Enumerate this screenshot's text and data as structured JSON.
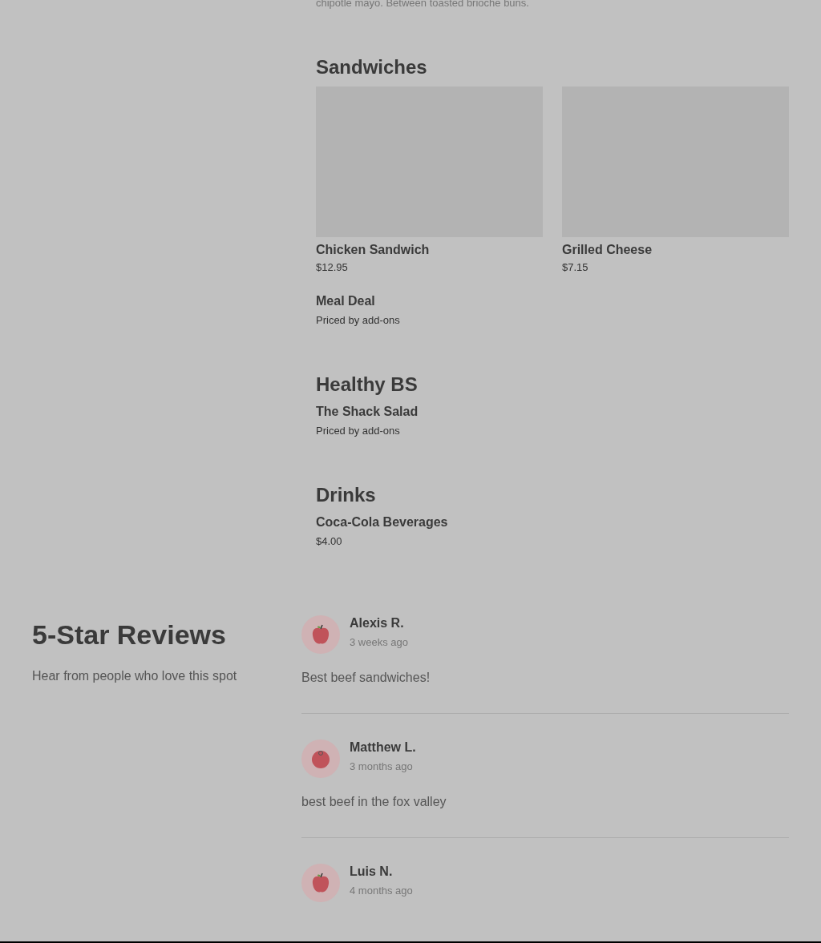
{
  "intro_text": "chipotle mayo. Between toasted brioche buns.",
  "menu_sections": [
    {
      "title": "Sandwiches",
      "items": [
        {
          "kind": "card",
          "name": "Chicken Sandwich",
          "price": "$12.95"
        },
        {
          "kind": "card",
          "name": "Grilled Cheese",
          "price": "$7.15"
        },
        {
          "kind": "row",
          "name": "Meal Deal",
          "price": "Priced by add-ons"
        }
      ]
    },
    {
      "title": "Healthy BS",
      "items": [
        {
          "kind": "row",
          "name": "The Shack Salad",
          "price": "Priced by add-ons"
        }
      ]
    },
    {
      "title": "Drinks",
      "items": [
        {
          "kind": "row",
          "name": "Coca-Cola Beverages",
          "price": "$4.00"
        }
      ]
    }
  ],
  "reviews": {
    "title": "5-Star Reviews",
    "subtitle": "Hear from people who love this spot",
    "items": [
      {
        "kind": "apple",
        "name": "Alexis R.",
        "time": "3 weeks ago",
        "text": "Best beef sandwiches!"
      },
      {
        "kind": "tomato",
        "name": "Matthew L.",
        "time": "3 months ago",
        "text": "best beef in the fox valley"
      },
      {
        "kind": "apple",
        "name": "Luis N.",
        "time": "4 months ago"
      }
    ]
  }
}
